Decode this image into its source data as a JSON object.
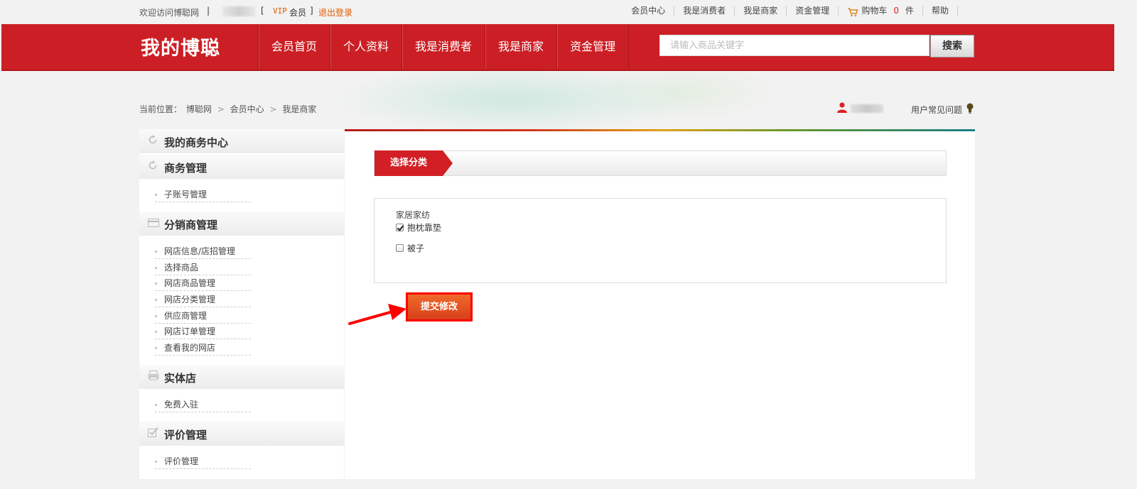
{
  "topbar": {
    "welcome": "欢迎访问博聪网",
    "separator": "|",
    "open_bracket": "[",
    "vip": "VIP",
    "member": "会员",
    "close_bracket": "]",
    "logout": "退出登录",
    "links": [
      "会员中心",
      "我是消费者",
      "我是商家",
      "资金管理"
    ],
    "cart_label": "购物车",
    "cart_count": "0",
    "cart_unit": "件",
    "help": "帮助"
  },
  "header": {
    "logo": "我的博聪",
    "nav": [
      "会员首页",
      "个人资料",
      "我是消费者",
      "我是商家",
      "资金管理"
    ],
    "search_placeholder": "请输入商品关键字",
    "search_button": "搜索"
  },
  "breadcrumb": {
    "label": "当前位置：",
    "items": [
      "博聪网",
      "会员中心",
      "我是商家"
    ],
    "sep": ">"
  },
  "faq": "用户常见问题",
  "sidebar": {
    "sections": [
      {
        "title": "我的商务中心",
        "icon": "refresh-icon",
        "items": []
      },
      {
        "title": "商务管理",
        "icon": "refresh-icon",
        "items": [
          "子账号管理"
        ]
      },
      {
        "title": "分销商管理",
        "icon": "card-icon",
        "items": [
          "网店信息/店招管理",
          "选择商品",
          "网店商品管理",
          "网店分类管理",
          "供应商管理",
          "网店订单管理",
          "查看我的网店"
        ]
      },
      {
        "title": "实体店",
        "icon": "printer-icon",
        "items": [
          "免费入驻"
        ]
      },
      {
        "title": "评价管理",
        "icon": "checkmark-icon",
        "items": [
          "评价管理"
        ]
      }
    ]
  },
  "main": {
    "tab_title": "选择分类",
    "group_label": "家居家纺",
    "options": [
      {
        "label": "抱枕靠垫",
        "checked": true
      },
      {
        "label": "被子",
        "checked": false
      }
    ],
    "submit": "提交修改"
  },
  "colors": {
    "brand_red": "#cc1f25",
    "link_orange": "#e05a00",
    "annotation_red": "#ff0000"
  }
}
